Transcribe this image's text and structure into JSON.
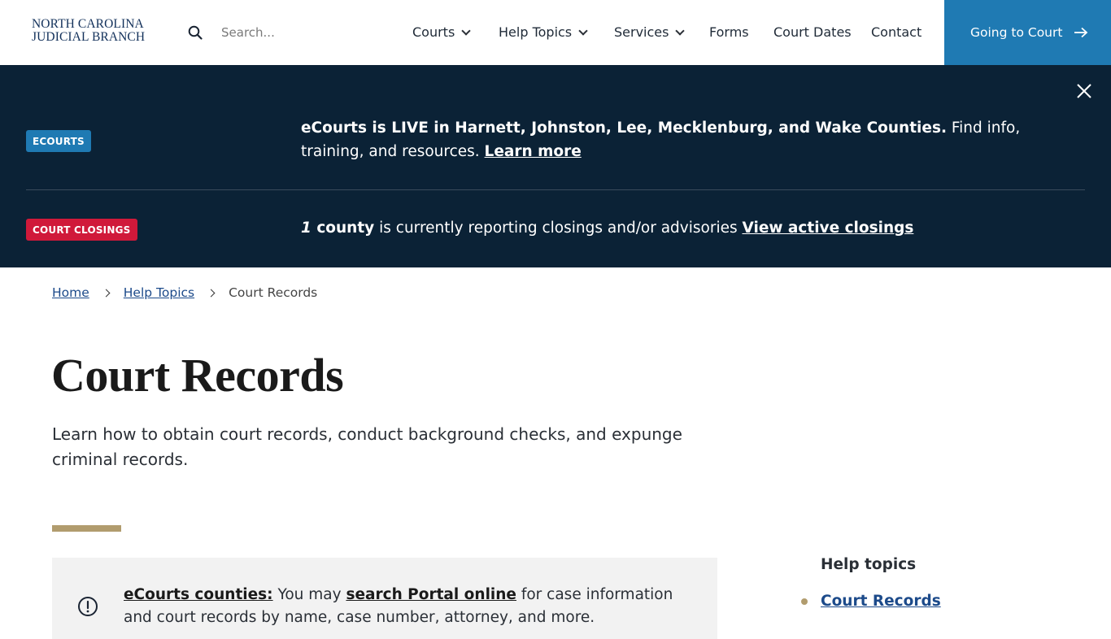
{
  "header": {
    "logo_line1": "NORTH CAROLINA",
    "logo_line2": "JUDICIAL BRANCH",
    "search_placeholder": "Search...",
    "nav": {
      "courts": "Courts",
      "help_topics": "Help Topics",
      "services": "Services",
      "forms": "Forms",
      "court_dates": "Court Dates",
      "contact": "Contact"
    },
    "cta_label": "Going to Court"
  },
  "alerts": {
    "ecourts_badge": "ECOURTS",
    "ecourts_bold": "eCourts is LIVE in Harnett, Johnston, Lee, Mecklenburg, and Wake Counties.",
    "ecourts_rest": " Find info, training, and resources. ",
    "ecourts_link": "Learn more",
    "closings_badge": "COURT CLOSINGS",
    "closings_count": "1",
    "closings_bold": " county",
    "closings_rest": " is currently reporting closings and/or advisories ",
    "closings_link": "View active closings"
  },
  "breadcrumb": {
    "home": "Home",
    "help_topics": "Help Topics",
    "current": "Court Records"
  },
  "main": {
    "title": "Court Records",
    "intro": "Learn how to obtain court records, conduct background checks, and expunge criminal records.",
    "notice_link1": "eCourts counties:",
    "notice_mid": " You may ",
    "notice_link2": "search Portal online",
    "notice_rest": " for case information and court records by name, case number, attorney, and more."
  },
  "sidebar": {
    "heading": "Help topics",
    "items": [
      {
        "label": "Court Records"
      }
    ]
  },
  "colors": {
    "brand_blue": "#1f7ab3",
    "alert_bg": "#0b2236",
    "closing_red": "#d0193a",
    "gold": "#b19c6e",
    "link_blue": "#1c4a8a"
  }
}
